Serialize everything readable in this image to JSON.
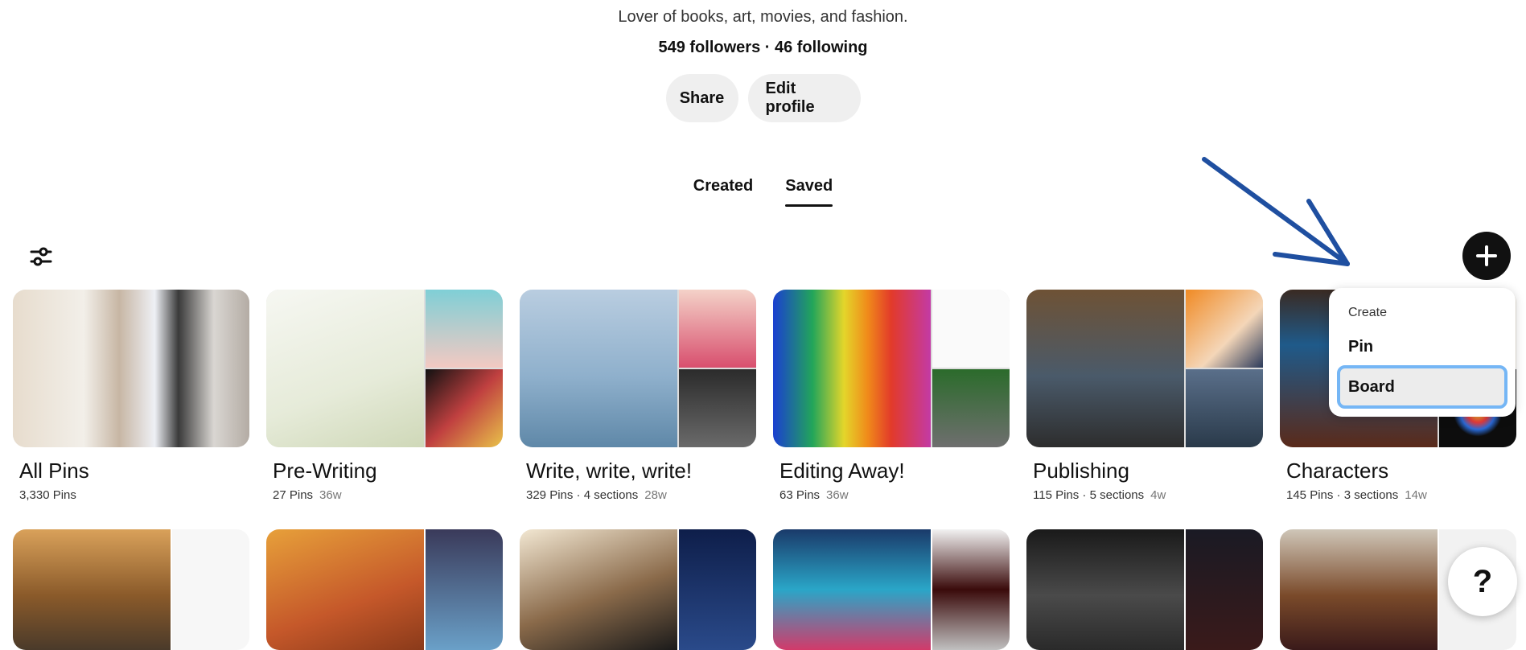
{
  "profile": {
    "bio": "Lover of books, art, movies, and fashion.",
    "stats": "549 followers · 46 following",
    "share_label": "Share",
    "edit_label": "Edit profile"
  },
  "tabs": [
    {
      "label": "Created",
      "active": false
    },
    {
      "label": "Saved",
      "active": true
    }
  ],
  "toolbar": {
    "filter_icon": "sliders-icon",
    "create_icon": "plus-icon",
    "annotation": "blue-arrow-pointing-to-create-menu"
  },
  "create_menu": {
    "heading": "Create",
    "items": [
      {
        "label": "Pin",
        "focused": false
      },
      {
        "label": "Board",
        "focused": true
      }
    ],
    "focus_color": "#75b6f5"
  },
  "boards": [
    {
      "title": "All Pins",
      "pins": "3,330 Pins",
      "sections": "",
      "age": ""
    },
    {
      "title": "Pre-Writing",
      "pins": "27 Pins",
      "sections": "",
      "age": "36w"
    },
    {
      "title": "Write, write, write!",
      "pins": "329 Pins",
      "sections": "4 sections",
      "age": "28w"
    },
    {
      "title": "Editing Away!",
      "pins": "63 Pins",
      "sections": "",
      "age": "36w"
    },
    {
      "title": "Publishing",
      "pins": "115 Pins",
      "sections": "5 sections",
      "age": "4w"
    },
    {
      "title": "Characters",
      "pins": "145 Pins",
      "sections": "3 sections",
      "age": "14w"
    }
  ],
  "help_label": "?"
}
